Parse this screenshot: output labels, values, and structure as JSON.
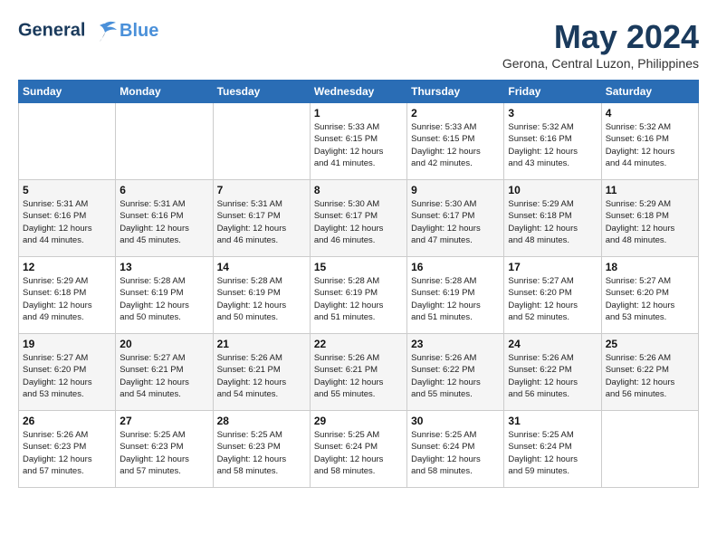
{
  "logo": {
    "line1": "General",
    "line2": "Blue"
  },
  "title": "May 2024",
  "location": "Gerona, Central Luzon, Philippines",
  "weekdays": [
    "Sunday",
    "Monday",
    "Tuesday",
    "Wednesday",
    "Thursday",
    "Friday",
    "Saturday"
  ],
  "weeks": [
    [
      {
        "day": "",
        "info": ""
      },
      {
        "day": "",
        "info": ""
      },
      {
        "day": "",
        "info": ""
      },
      {
        "day": "1",
        "info": "Sunrise: 5:33 AM\nSunset: 6:15 PM\nDaylight: 12 hours\nand 41 minutes."
      },
      {
        "day": "2",
        "info": "Sunrise: 5:33 AM\nSunset: 6:15 PM\nDaylight: 12 hours\nand 42 minutes."
      },
      {
        "day": "3",
        "info": "Sunrise: 5:32 AM\nSunset: 6:16 PM\nDaylight: 12 hours\nand 43 minutes."
      },
      {
        "day": "4",
        "info": "Sunrise: 5:32 AM\nSunset: 6:16 PM\nDaylight: 12 hours\nand 44 minutes."
      }
    ],
    [
      {
        "day": "5",
        "info": "Sunrise: 5:31 AM\nSunset: 6:16 PM\nDaylight: 12 hours\nand 44 minutes."
      },
      {
        "day": "6",
        "info": "Sunrise: 5:31 AM\nSunset: 6:16 PM\nDaylight: 12 hours\nand 45 minutes."
      },
      {
        "day": "7",
        "info": "Sunrise: 5:31 AM\nSunset: 6:17 PM\nDaylight: 12 hours\nand 46 minutes."
      },
      {
        "day": "8",
        "info": "Sunrise: 5:30 AM\nSunset: 6:17 PM\nDaylight: 12 hours\nand 46 minutes."
      },
      {
        "day": "9",
        "info": "Sunrise: 5:30 AM\nSunset: 6:17 PM\nDaylight: 12 hours\nand 47 minutes."
      },
      {
        "day": "10",
        "info": "Sunrise: 5:29 AM\nSunset: 6:18 PM\nDaylight: 12 hours\nand 48 minutes."
      },
      {
        "day": "11",
        "info": "Sunrise: 5:29 AM\nSunset: 6:18 PM\nDaylight: 12 hours\nand 48 minutes."
      }
    ],
    [
      {
        "day": "12",
        "info": "Sunrise: 5:29 AM\nSunset: 6:18 PM\nDaylight: 12 hours\nand 49 minutes."
      },
      {
        "day": "13",
        "info": "Sunrise: 5:28 AM\nSunset: 6:19 PM\nDaylight: 12 hours\nand 50 minutes."
      },
      {
        "day": "14",
        "info": "Sunrise: 5:28 AM\nSunset: 6:19 PM\nDaylight: 12 hours\nand 50 minutes."
      },
      {
        "day": "15",
        "info": "Sunrise: 5:28 AM\nSunset: 6:19 PM\nDaylight: 12 hours\nand 51 minutes."
      },
      {
        "day": "16",
        "info": "Sunrise: 5:28 AM\nSunset: 6:19 PM\nDaylight: 12 hours\nand 51 minutes."
      },
      {
        "day": "17",
        "info": "Sunrise: 5:27 AM\nSunset: 6:20 PM\nDaylight: 12 hours\nand 52 minutes."
      },
      {
        "day": "18",
        "info": "Sunrise: 5:27 AM\nSunset: 6:20 PM\nDaylight: 12 hours\nand 53 minutes."
      }
    ],
    [
      {
        "day": "19",
        "info": "Sunrise: 5:27 AM\nSunset: 6:20 PM\nDaylight: 12 hours\nand 53 minutes."
      },
      {
        "day": "20",
        "info": "Sunrise: 5:27 AM\nSunset: 6:21 PM\nDaylight: 12 hours\nand 54 minutes."
      },
      {
        "day": "21",
        "info": "Sunrise: 5:26 AM\nSunset: 6:21 PM\nDaylight: 12 hours\nand 54 minutes."
      },
      {
        "day": "22",
        "info": "Sunrise: 5:26 AM\nSunset: 6:21 PM\nDaylight: 12 hours\nand 55 minutes."
      },
      {
        "day": "23",
        "info": "Sunrise: 5:26 AM\nSunset: 6:22 PM\nDaylight: 12 hours\nand 55 minutes."
      },
      {
        "day": "24",
        "info": "Sunrise: 5:26 AM\nSunset: 6:22 PM\nDaylight: 12 hours\nand 56 minutes."
      },
      {
        "day": "25",
        "info": "Sunrise: 5:26 AM\nSunset: 6:22 PM\nDaylight: 12 hours\nand 56 minutes."
      }
    ],
    [
      {
        "day": "26",
        "info": "Sunrise: 5:26 AM\nSunset: 6:23 PM\nDaylight: 12 hours\nand 57 minutes."
      },
      {
        "day": "27",
        "info": "Sunrise: 5:25 AM\nSunset: 6:23 PM\nDaylight: 12 hours\nand 57 minutes."
      },
      {
        "day": "28",
        "info": "Sunrise: 5:25 AM\nSunset: 6:23 PM\nDaylight: 12 hours\nand 58 minutes."
      },
      {
        "day": "29",
        "info": "Sunrise: 5:25 AM\nSunset: 6:24 PM\nDaylight: 12 hours\nand 58 minutes."
      },
      {
        "day": "30",
        "info": "Sunrise: 5:25 AM\nSunset: 6:24 PM\nDaylight: 12 hours\nand 58 minutes."
      },
      {
        "day": "31",
        "info": "Sunrise: 5:25 AM\nSunset: 6:24 PM\nDaylight: 12 hours\nand 59 minutes."
      },
      {
        "day": "",
        "info": ""
      }
    ]
  ]
}
